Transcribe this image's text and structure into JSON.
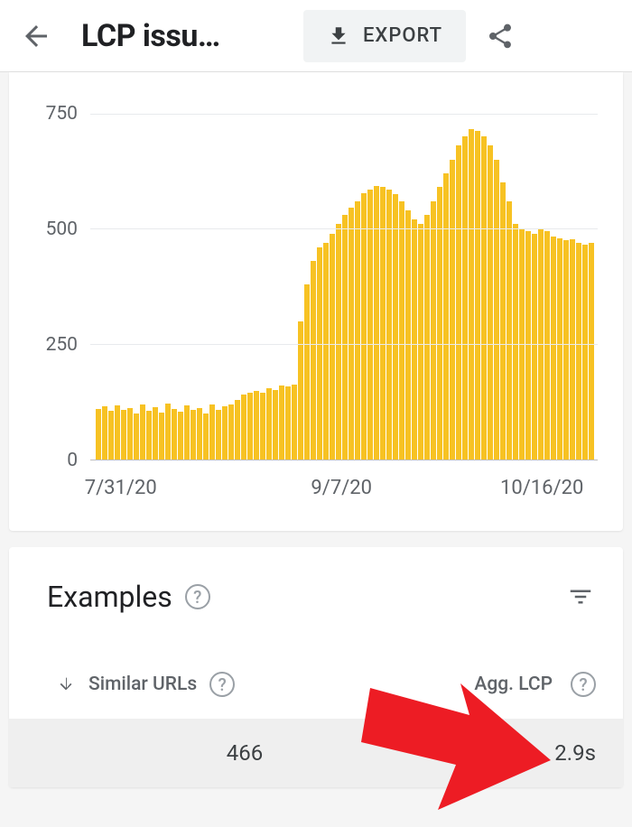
{
  "header": {
    "title": "LCP issu…",
    "export_label": "EXPORT"
  },
  "chart_data": {
    "type": "bar",
    "title": "",
    "xlabel": "",
    "ylabel": "",
    "ylim": [
      0,
      800
    ],
    "yticks": [
      0,
      250,
      500,
      750
    ],
    "xticks": [
      "7/31/20",
      "9/7/20",
      "10/16/20"
    ],
    "xtick_positions": [
      0.06,
      0.495,
      0.89
    ],
    "values": [
      110,
      115,
      105,
      118,
      108,
      112,
      100,
      120,
      106,
      114,
      102,
      122,
      110,
      104,
      118,
      108,
      112,
      100,
      120,
      108,
      116,
      120,
      130,
      140,
      145,
      148,
      145,
      155,
      150,
      160,
      158,
      162,
      300,
      380,
      430,
      460,
      470,
      490,
      510,
      530,
      545,
      560,
      578,
      585,
      592,
      590,
      585,
      575,
      560,
      540,
      520,
      510,
      530,
      560,
      590,
      620,
      650,
      680,
      700,
      715,
      712,
      700,
      680,
      650,
      600,
      560,
      510,
      500,
      495,
      490,
      500,
      495,
      483,
      480,
      475,
      478,
      470,
      465,
      470
    ]
  },
  "examples": {
    "title": "Examples",
    "columns": {
      "similar_urls": "Similar URLs",
      "agg_lcp": "Agg. LCP"
    },
    "row": {
      "count": "466",
      "lcp": "2.9s"
    }
  }
}
